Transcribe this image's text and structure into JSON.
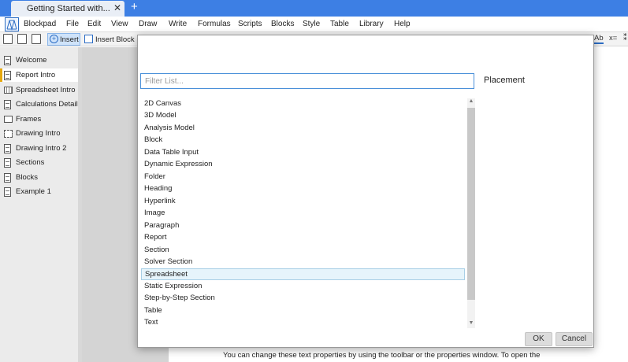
{
  "tab": {
    "title": "Getting Started with...",
    "close": "✕",
    "new": "+"
  },
  "app": {
    "name": "Blockpad"
  },
  "menu": [
    "File",
    "Edit",
    "View",
    "Draw",
    "Write",
    "Formulas",
    "Scripts",
    "Blocks",
    "Style",
    "Table",
    "Library",
    "Help"
  ],
  "toolbar": {
    "insert": "Insert",
    "insert_block": "Insert Block",
    "ab": "Ab",
    "x": "x=",
    "extra": "⁑"
  },
  "sidebar": {
    "items": [
      {
        "label": "Welcome",
        "icon": "document-icon"
      },
      {
        "label": "Report Intro",
        "icon": "document-icon",
        "active": true
      },
      {
        "label": "Spreadsheet Intro",
        "icon": "spreadsheet-icon"
      },
      {
        "label": "Calculations Detail",
        "icon": "document-icon"
      },
      {
        "label": "Frames",
        "icon": "frame-icon"
      },
      {
        "label": "Drawing Intro",
        "icon": "drawing-icon"
      },
      {
        "label": "Drawing Intro 2",
        "icon": "document-icon"
      },
      {
        "label": "Sections",
        "icon": "document-icon"
      },
      {
        "label": "Blocks",
        "icon": "document-icon"
      },
      {
        "label": "Example 1",
        "icon": "document-icon"
      }
    ]
  },
  "dialog": {
    "filter_placeholder": "Filter List...",
    "placement_label": "Placement",
    "items": [
      "2D Canvas",
      "3D Model",
      "Analysis Model",
      "Block",
      "Data Table Input",
      "Dynamic Expression",
      "Folder",
      "Heading",
      "Hyperlink",
      "Image",
      "Paragraph",
      "Report",
      "Section",
      "Solver Section",
      "Spreadsheet",
      "Static Expression",
      "Step-by-Step Section",
      "Table",
      "Text"
    ],
    "selected": "Spreadsheet",
    "ok": "OK",
    "cancel": "Cancel"
  },
  "page": {
    "text": "You can change these text properties by using the toolbar or the properties window. To open the"
  },
  "colors": {
    "accent": "#3d7fe4",
    "selection": "#e6f4fb",
    "active_marker": "#e6a80e"
  }
}
